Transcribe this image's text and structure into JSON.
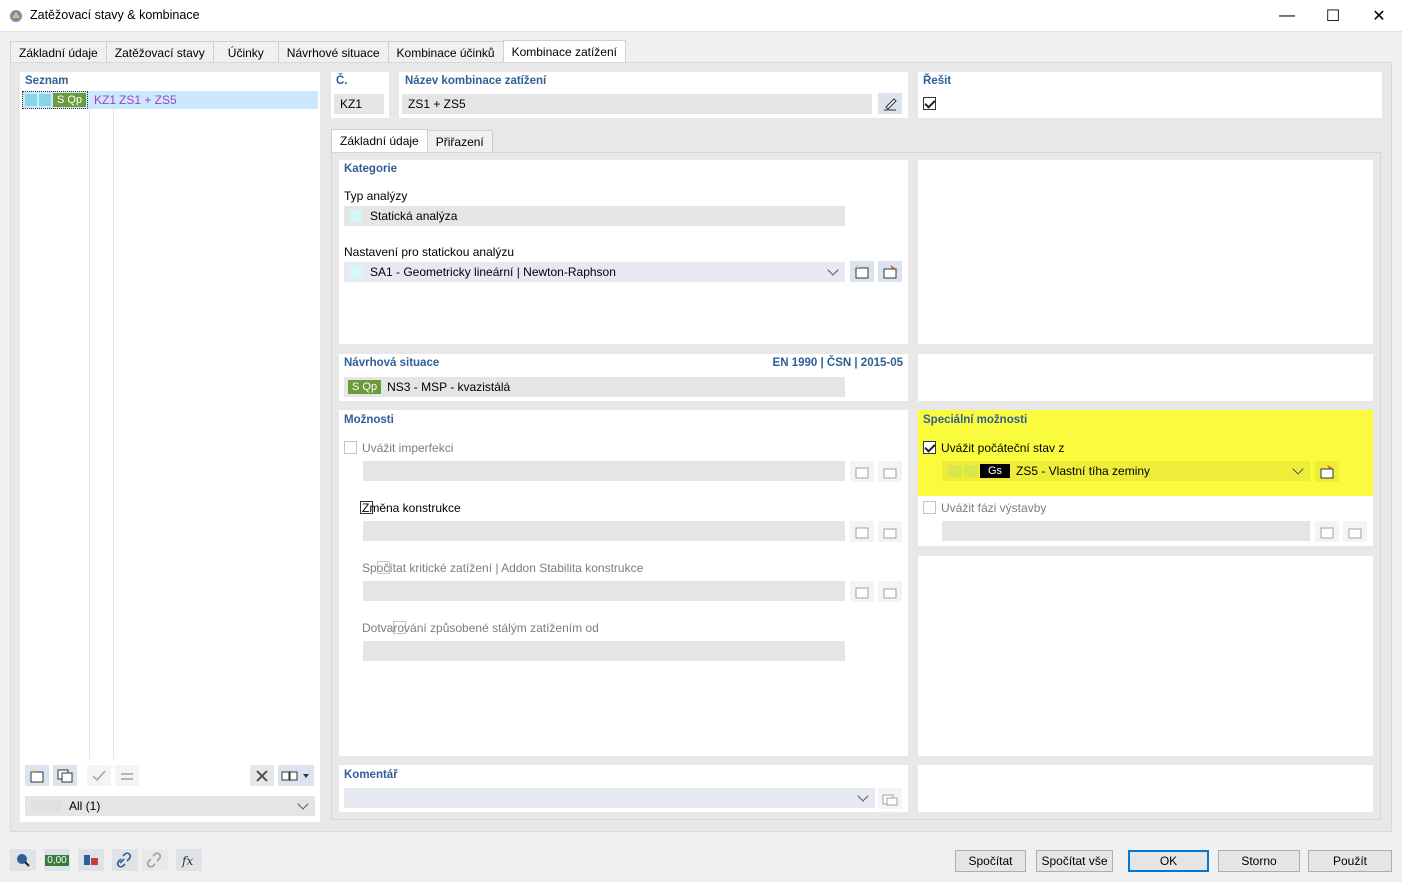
{
  "window": {
    "title": "Zatěžovací stavy & kombinace",
    "minimize": "—",
    "maximize": "☐",
    "close": "✕"
  },
  "tabs": [
    {
      "label": "Základní údaje"
    },
    {
      "label": "Zatěžovací stavy"
    },
    {
      "label": "Účinky"
    },
    {
      "label": "Návrhové situace"
    },
    {
      "label": "Kombinace účinků"
    },
    {
      "label": "Kombinace zatížení"
    }
  ],
  "list": {
    "header": "Seznam",
    "items": [
      {
        "badge": "S Qp",
        "id": "KZ1",
        "name": "ZS1 + ZS5"
      }
    ],
    "filter": "All (1)"
  },
  "number": {
    "label": "Č.",
    "value": "KZ1"
  },
  "name": {
    "label": "Název kombinace zatížení",
    "value": "ZS1 + ZS5"
  },
  "solve": {
    "label": "Řešit"
  },
  "subtabs": [
    {
      "label": "Základní údaje"
    },
    {
      "label": "Přiřazení"
    }
  ],
  "category": {
    "header": "Kategorie",
    "analysis_type_label": "Typ analýzy",
    "analysis_type_value": "Statická analýza",
    "settings_label": "Nastavení pro statickou analýzu",
    "settings_value": "SA1 - Geometricky lineární | Newton-Raphson"
  },
  "design_situation": {
    "header": "Návrhová situace",
    "standard": "EN 1990 | ČSN | 2015-05",
    "badge": "S Qp",
    "value": "NS3 - MSP - kvazistálá"
  },
  "options": {
    "header": "Možnosti",
    "imperfection": "Uvážit imperfekci",
    "structure_change": "Změna konstrukce",
    "critical_load": "Spočítat kritické zatížení | Addon Stabilita konstrukce",
    "prestress": "Dotvarování způsobené stálým zatížením od"
  },
  "special": {
    "header": "Speciální možnosti",
    "initial_state": "Uvážit počáteční stav z",
    "initial_badge": "Gs",
    "initial_value": "ZS5 - Vlastní tíha zeminy",
    "construction_stage": "Uvážit fázi výstavby"
  },
  "comment": {
    "header": "Komentář"
  },
  "buttons": {
    "calculate": "Spočítat",
    "calculate_all": "Spočítat vše",
    "ok": "OK",
    "cancel": "Storno",
    "apply": "Použít"
  },
  "toolbar_value": "0,00",
  "colors": {
    "accent": "#2e5f96",
    "highlight": "#fbfb3d",
    "badge_green": "#6b9b3a",
    "selection": "#cce8ff"
  }
}
